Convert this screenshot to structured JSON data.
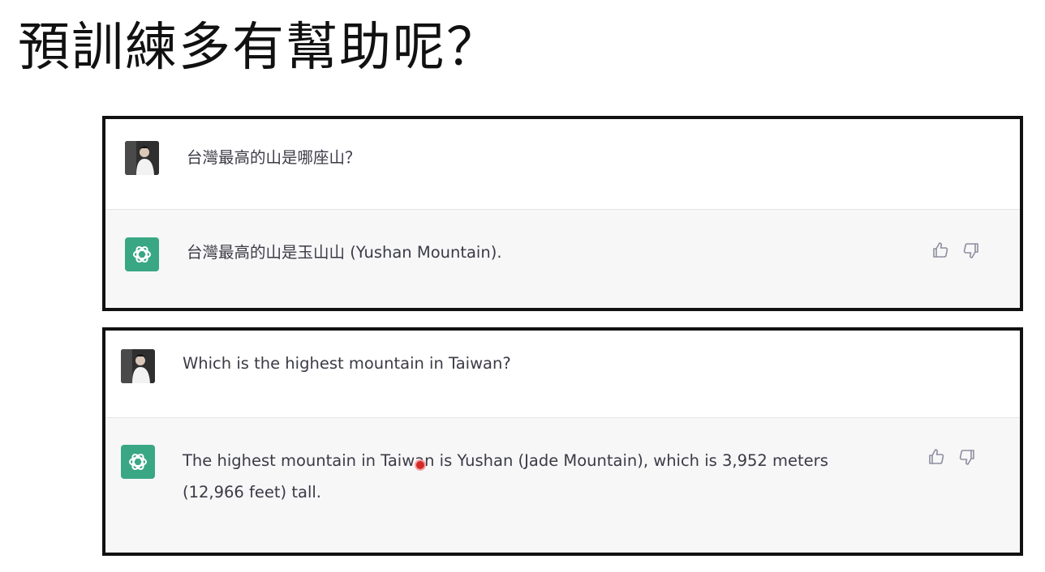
{
  "slide": {
    "title": "預訓練多有幫助呢？"
  },
  "conversation_zh": {
    "user_message": "台灣最高的山是哪座山？",
    "assistant_message": "台灣最高的山是玉山山 (Yushan Mountain)."
  },
  "conversation_en": {
    "user_message": "Which is the highest mountain in Taiwan?",
    "assistant_message_line1": "The highest mountain in Taiwan is Yushan (Jade Mountain), which is 3,952 meters",
    "assistant_message_line2": "(12,966 feet) tall."
  },
  "icons": {
    "user_avatar": "user-photo-icon",
    "assistant_avatar": "openai-logo-icon",
    "like": "thumbs-up-icon",
    "dislike": "thumbs-down-icon"
  },
  "colors": {
    "assistant_avatar_bg": "#3aa784",
    "assistant_row_bg": "#f7f7f8",
    "message_text": "#3b3b46",
    "frame_border": "#111111",
    "cursor_marker": "#d42a2a"
  }
}
